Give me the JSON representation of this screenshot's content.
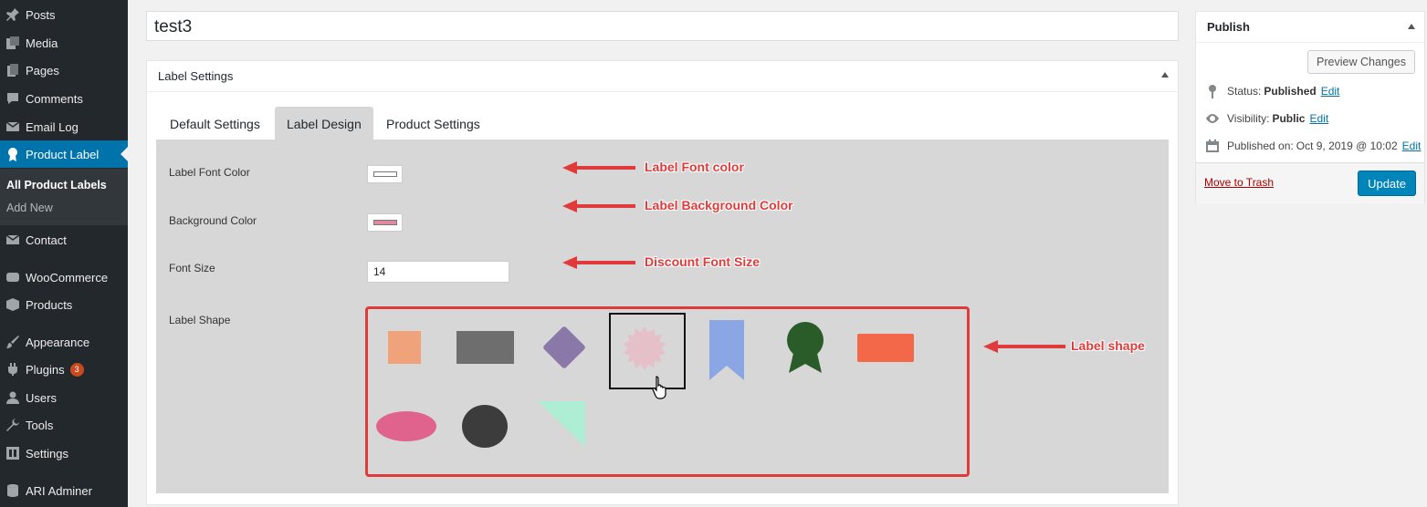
{
  "sidebar": {
    "items": [
      {
        "label": "Posts",
        "icon": "pushpin-icon"
      },
      {
        "label": "Media",
        "icon": "media-icon"
      },
      {
        "label": "Pages",
        "icon": "pages-icon"
      },
      {
        "label": "Comments",
        "icon": "comments-icon"
      },
      {
        "label": "Email Log",
        "icon": "email-icon"
      },
      {
        "label": "Product Label",
        "icon": "award-icon"
      },
      {
        "label": "Contact",
        "icon": "mail-icon"
      },
      {
        "label": "WooCommerce",
        "icon": "woocommerce-icon"
      },
      {
        "label": "Products",
        "icon": "box-icon"
      },
      {
        "label": "Appearance",
        "icon": "brush-icon"
      },
      {
        "label": "Plugins",
        "icon": "plugin-icon",
        "badge": "3"
      },
      {
        "label": "Users",
        "icon": "user-icon"
      },
      {
        "label": "Tools",
        "icon": "wrench-icon"
      },
      {
        "label": "Settings",
        "icon": "settings-icon"
      },
      {
        "label": "ARI Adminer",
        "icon": "database-icon"
      }
    ],
    "submenu": [
      {
        "label": "All Product Labels"
      },
      {
        "label": "Add New"
      }
    ]
  },
  "post": {
    "title": "test3"
  },
  "label_settings": {
    "title": "Label Settings",
    "tabs": [
      {
        "label": "Default Settings"
      },
      {
        "label": "Label Design"
      },
      {
        "label": "Product Settings"
      }
    ],
    "fields": {
      "font_color_label": "Label Font Color",
      "font_color_value": "#ffffff",
      "bg_color_label": "Background Color",
      "bg_color_value": "#e08aa0",
      "font_size_label": "Font Size",
      "font_size_value": "14",
      "shape_label": "Label Shape"
    },
    "shapes": [
      {
        "name": "square",
        "color": "#f0a27a"
      },
      {
        "name": "rectangle",
        "color": "#6e6e6e"
      },
      {
        "name": "diamond",
        "color": "#8a78a8"
      },
      {
        "name": "starburst",
        "color": "#e5c0c8",
        "selected": true
      },
      {
        "name": "bookmark",
        "color": "#8aa6e4"
      },
      {
        "name": "rosette",
        "color": "#2a5c2a"
      },
      {
        "name": "wide-rectangle",
        "color": "#f26849"
      },
      {
        "name": "oval",
        "color": "#e0638e"
      },
      {
        "name": "circle",
        "color": "#3c3c3c"
      },
      {
        "name": "triangle",
        "color": "#aeeed4"
      }
    ]
  },
  "annotations": {
    "font_color": "Label Font color",
    "bg_color": "Label Background Color",
    "font_size": "Discount Font Size",
    "shape": "Label shape"
  },
  "publish": {
    "title": "Publish",
    "preview": "Preview Changes",
    "status_label": "Status:",
    "status_value": "Published",
    "visibility_label": "Visibility:",
    "visibility_value": "Public",
    "published_label": "Published on:",
    "published_value": "Oct 9, 2019 @ 10:02",
    "edit": "Edit",
    "trash": "Move to Trash",
    "update": "Update"
  },
  "colors": {
    "accent": "#0073aa",
    "annotation": "#e03a3a",
    "sidebar": "#23282d"
  }
}
